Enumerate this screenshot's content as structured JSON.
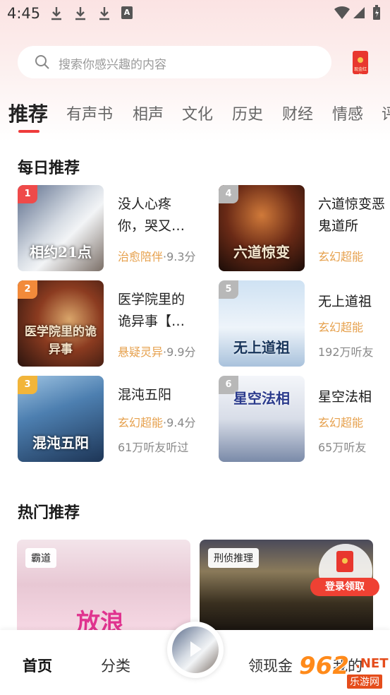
{
  "status_bar": {
    "time": "4:45",
    "a_badge": "A"
  },
  "search": {
    "placeholder": "搜索你感兴趣的内容"
  },
  "redpacket": {
    "label": "现金红包"
  },
  "tabs": [
    "推荐",
    "有声书",
    "相声",
    "文化",
    "历史",
    "财经",
    "情感",
    "评"
  ],
  "daily": {
    "title": "每日推荐",
    "items": [
      {
        "rank": "1",
        "cover_text": "相约21点",
        "title": "没人心疼你，哭又…",
        "category": "治愈陪伴",
        "score": "·9.3分",
        "listeners": ""
      },
      {
        "rank": "2",
        "cover_text": "医学院里的诡异事",
        "title": "医学院里的诡异事【…",
        "category": "悬疑灵异",
        "score": "·9.9分",
        "listeners": ""
      },
      {
        "rank": "3",
        "cover_text": "混沌五阳",
        "title": "混沌五阳",
        "category": "玄幻超能",
        "score": "·9.4分",
        "listeners": "61万听友听过"
      },
      {
        "rank": "4",
        "cover_text": "六道惊变",
        "title": "六道惊变恶鬼道所",
        "category": "玄幻超能",
        "score": "",
        "listeners": ""
      },
      {
        "rank": "5",
        "cover_text": "无上道祖",
        "title": "无上道祖",
        "category": "玄幻超能",
        "score": "",
        "listeners": "192万听友"
      },
      {
        "rank": "6",
        "cover_text": "星空法相",
        "title": "星空法相",
        "category": "玄幻超能",
        "score": "",
        "listeners": "65万听友"
      }
    ]
  },
  "hot": {
    "title": "热门推荐",
    "cards": [
      {
        "tag": "霸道",
        "cover_text": "放浪"
      },
      {
        "tag": "刑侦推理",
        "cover_text": ""
      }
    ],
    "login_reward": "登录领取"
  },
  "bottom_nav": [
    "首页",
    "分类",
    "领现金",
    "我的"
  ],
  "watermark": {
    "num": "962",
    "net": ".NET",
    "sub": "乐游网"
  },
  "colors": {
    "accent": "#ef3a3a",
    "category": "#e6a04c",
    "rank1": "#ef4a4a",
    "rank2": "#f28a3a",
    "rank3": "#f2b53a",
    "rank_other": "#b8b8b8"
  }
}
